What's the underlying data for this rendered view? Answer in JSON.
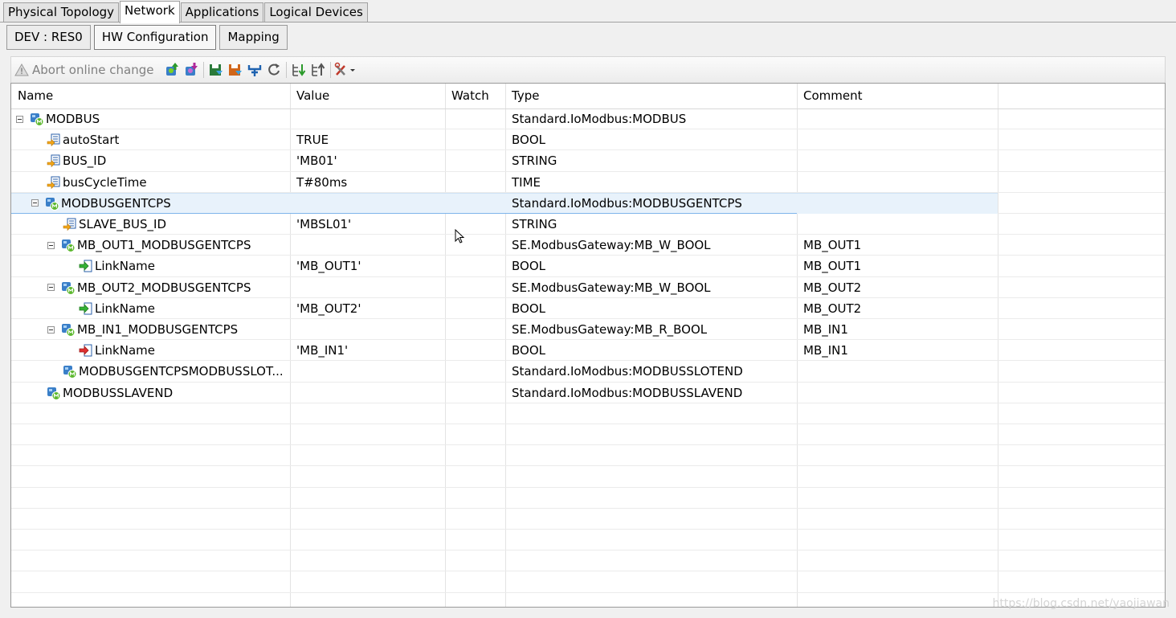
{
  "top_tabs": [
    "Physical Topology",
    "Network",
    "Applications",
    "Logical Devices"
  ],
  "sub_tabs": [
    "DEV : RES0",
    "HW Configuration",
    "Mapping"
  ],
  "toolbar": {
    "abort_label": "Abort online change",
    "icons": [
      "upload-icon",
      "download-icon",
      "save-icon",
      "export-icon",
      "network-icon",
      "refresh-icon",
      "expand-tree-icon",
      "collapse-tree-icon",
      "tools-menu-icon"
    ]
  },
  "columns": {
    "name": "Name",
    "value": "Value",
    "watch": "Watch",
    "type": "Type",
    "comment": "Comment"
  },
  "rows": [
    {
      "name": "MODBUS",
      "value": "",
      "type": "Standard.IoModbus:MODBUS",
      "comment": "",
      "level": 0,
      "expander": true,
      "icon": "device-icon"
    },
    {
      "name": "autoStart",
      "value": "TRUE",
      "type": "BOOL",
      "comment": "",
      "level": 1,
      "expander": false,
      "icon": "parameter-icon"
    },
    {
      "name": "BUS_ID",
      "value": "'MB01'",
      "type": "STRING",
      "comment": "",
      "level": 1,
      "expander": false,
      "icon": "parameter-icon"
    },
    {
      "name": "busCycleTime",
      "value": "T#80ms",
      "type": "TIME",
      "comment": "",
      "level": 1,
      "expander": false,
      "icon": "parameter-icon"
    },
    {
      "name": "MODBUSGENTCPS",
      "value": "",
      "type": "Standard.IoModbus:MODBUSGENTCPS",
      "comment": "",
      "level": 1,
      "expander": true,
      "icon": "device-icon",
      "selected": true
    },
    {
      "name": "SLAVE_BUS_ID",
      "value": "'MBSL01'",
      "type": "STRING",
      "comment": "",
      "level": 2,
      "expander": false,
      "icon": "parameter-icon"
    },
    {
      "name": "MB_OUT1_MODBUSGENTCPS",
      "value": "",
      "type": "SE.ModbusGateway:MB_W_BOOL",
      "comment": "MB_OUT1",
      "level": 2,
      "expander": true,
      "icon": "device-icon"
    },
    {
      "name": "LinkName",
      "value": "'MB_OUT1'",
      "type": "BOOL",
      "comment": "MB_OUT1",
      "level": 3,
      "expander": false,
      "icon": "output-link-icon"
    },
    {
      "name": "MB_OUT2_MODBUSGENTCPS",
      "value": "",
      "type": "SE.ModbusGateway:MB_W_BOOL",
      "comment": "MB_OUT2",
      "level": 2,
      "expander": true,
      "icon": "device-icon"
    },
    {
      "name": "LinkName",
      "value": "'MB_OUT2'",
      "type": "BOOL",
      "comment": "MB_OUT2",
      "level": 3,
      "expander": false,
      "icon": "output-link-icon"
    },
    {
      "name": "MB_IN1_MODBUSGENTCPS",
      "value": "",
      "type": "SE.ModbusGateway:MB_R_BOOL",
      "comment": "MB_IN1",
      "level": 2,
      "expander": true,
      "icon": "device-icon"
    },
    {
      "name": "LinkName",
      "value": "'MB_IN1'",
      "type": "BOOL",
      "comment": "MB_IN1",
      "level": 3,
      "expander": false,
      "icon": "input-link-icon"
    },
    {
      "name": "MODBUSGENTCPSMODBUSSLOT...",
      "value": "",
      "type": "Standard.IoModbus:MODBUSSLOTEND",
      "comment": "",
      "level": 2,
      "expander": false,
      "icon": "device-icon"
    },
    {
      "name": "MODBUSSLAVEND",
      "value": "",
      "type": "Standard.IoModbus:MODBUSSLAVEND",
      "comment": "",
      "level": 1,
      "expander": false,
      "icon": "device-icon"
    }
  ],
  "watermark": "https://blog.csdn.net/yaojiawan",
  "colors": {
    "selection": "#e8f2fb",
    "device_icon": "#3a7fc8",
    "param_icon": "#e2a020",
    "output_icon": "#2aa52a",
    "input_icon": "#d22a2a"
  }
}
